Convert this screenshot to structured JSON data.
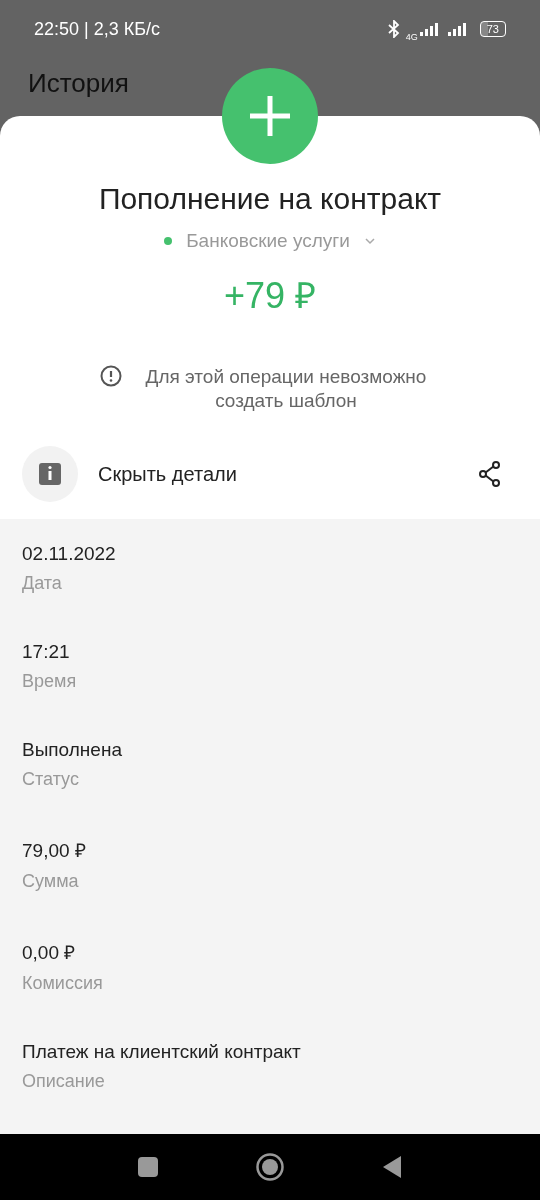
{
  "status_bar": {
    "time": "22:50 | 2,3 КБ/с",
    "network": "4G",
    "battery": "73"
  },
  "header": {
    "title": "История"
  },
  "operation": {
    "title": "Пополнение на контракт",
    "category": "Банковские услуги",
    "amount": "+79 ₽",
    "notice": "Для этой операции невозможно создать шаблон"
  },
  "details_toggle": {
    "label": "Скрыть детали"
  },
  "details": [
    {
      "value": "02.11.2022",
      "label": "Дата"
    },
    {
      "value": "17:21",
      "label": "Время"
    },
    {
      "value": "Выполнена",
      "label": "Статус"
    },
    {
      "value": "79,00 ₽",
      "label": "Сумма"
    },
    {
      "value": "0,00 ₽",
      "label": "Комиссия"
    },
    {
      "value": "Платеж на клиентский контракт",
      "label": "Описание"
    }
  ]
}
